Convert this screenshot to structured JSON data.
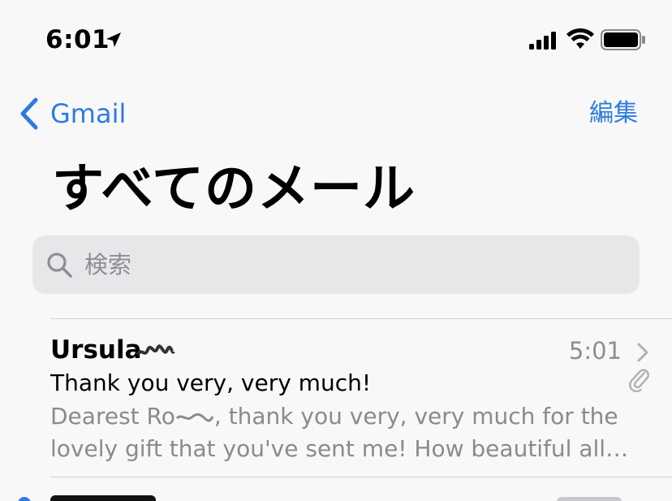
{
  "status_bar": {
    "time": "6:01"
  },
  "nav": {
    "back_label": "Gmail",
    "edit_label": "編集"
  },
  "page": {
    "title": "すべてのメール"
  },
  "search": {
    "placeholder": "検索",
    "value": ""
  },
  "mails": [
    {
      "sender": "Ursula",
      "time": "5:01",
      "subject": "Thank you very, very much!",
      "preview_line1_start": "Dearest Ro",
      "preview_line1_end": ", thank you very, very much for the",
      "preview_line2": "lovely gift that you've sent me! How beautiful all th…",
      "has_attachment": true
    }
  ],
  "colors": {
    "accent": "#2e7be0",
    "background": "#f8f8f8",
    "search_bg": "#e7e7ea",
    "secondary_text": "#8e8e93"
  }
}
